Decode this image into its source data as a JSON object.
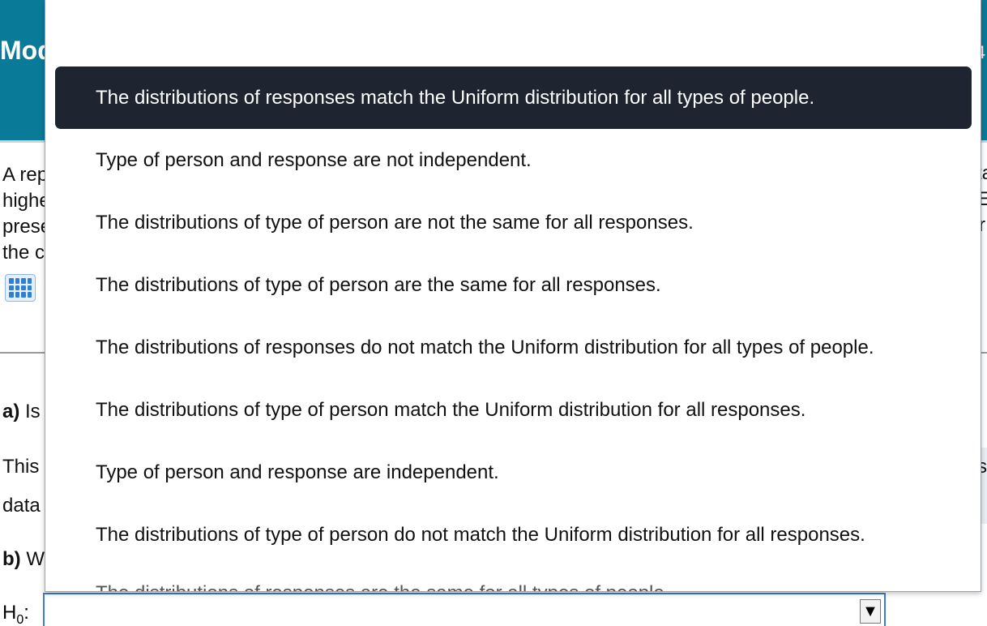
{
  "header": {
    "title_fragment": "Mod",
    "right_fragment": "4"
  },
  "question": {
    "lines": [
      "A rep",
      "highe",
      "prese",
      "the c"
    ],
    "right_fragments": [
      "ta",
      "E",
      "r"
    ]
  },
  "parts": {
    "a_label": "a)",
    "a_text": "Is",
    "this_text": "This",
    "data_text": "data",
    "b_label": "b)",
    "b_text": "W",
    "right_s": "s"
  },
  "hypothesis": {
    "label": "H",
    "sub": "0",
    "colon": ":",
    "arrow": "▼"
  },
  "dropdown": {
    "options": [
      "The distributions of responses match the Uniform distribution for all types of people.",
      "Type of person and response are not independent.",
      "The distributions of type of person are not the same for all responses.",
      "The distributions of type of person are the same for all responses.",
      "The distributions of responses do not match the Uniform distribution for all types of people.",
      "The distributions of type of person match the Uniform distribution for all responses.",
      "Type of person and response are independent.",
      "The distributions of type of person do not match the Uniform distribution for all responses.",
      "The distributions of responses are the same for all types of people."
    ],
    "selected_index": 0
  },
  "colors": {
    "header_bg": "#0a7a99",
    "selected_bg": "#1f2530",
    "select_border": "#3d7bd0"
  }
}
